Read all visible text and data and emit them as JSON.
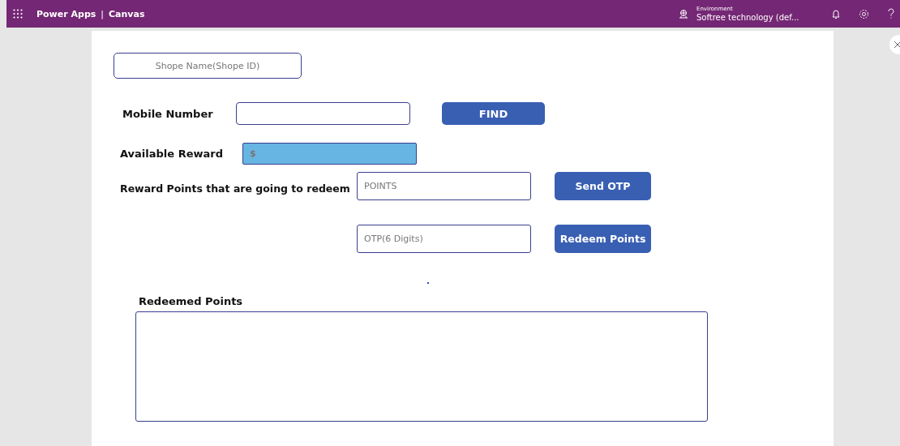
{
  "header": {
    "app_name": "Power Apps",
    "separator": "|",
    "section": "Canvas",
    "environment_label": "Environment",
    "environment_name": "Softree technology (def..."
  },
  "shop_field": {
    "placeholder": "Shope Name(Shope ID)"
  },
  "mobile": {
    "label": "Mobile Number",
    "button": "FIND"
  },
  "reward": {
    "label": "Available Reward",
    "value": "$"
  },
  "redeem": {
    "label": "Reward Points that are going to redeem",
    "points_placeholder": "POINTS",
    "send_button": "Send OTP",
    "otp_placeholder": "OTP(6 Digits)",
    "redeem_button": "Redeem Points"
  },
  "history": {
    "label": "Redeemed Points"
  }
}
